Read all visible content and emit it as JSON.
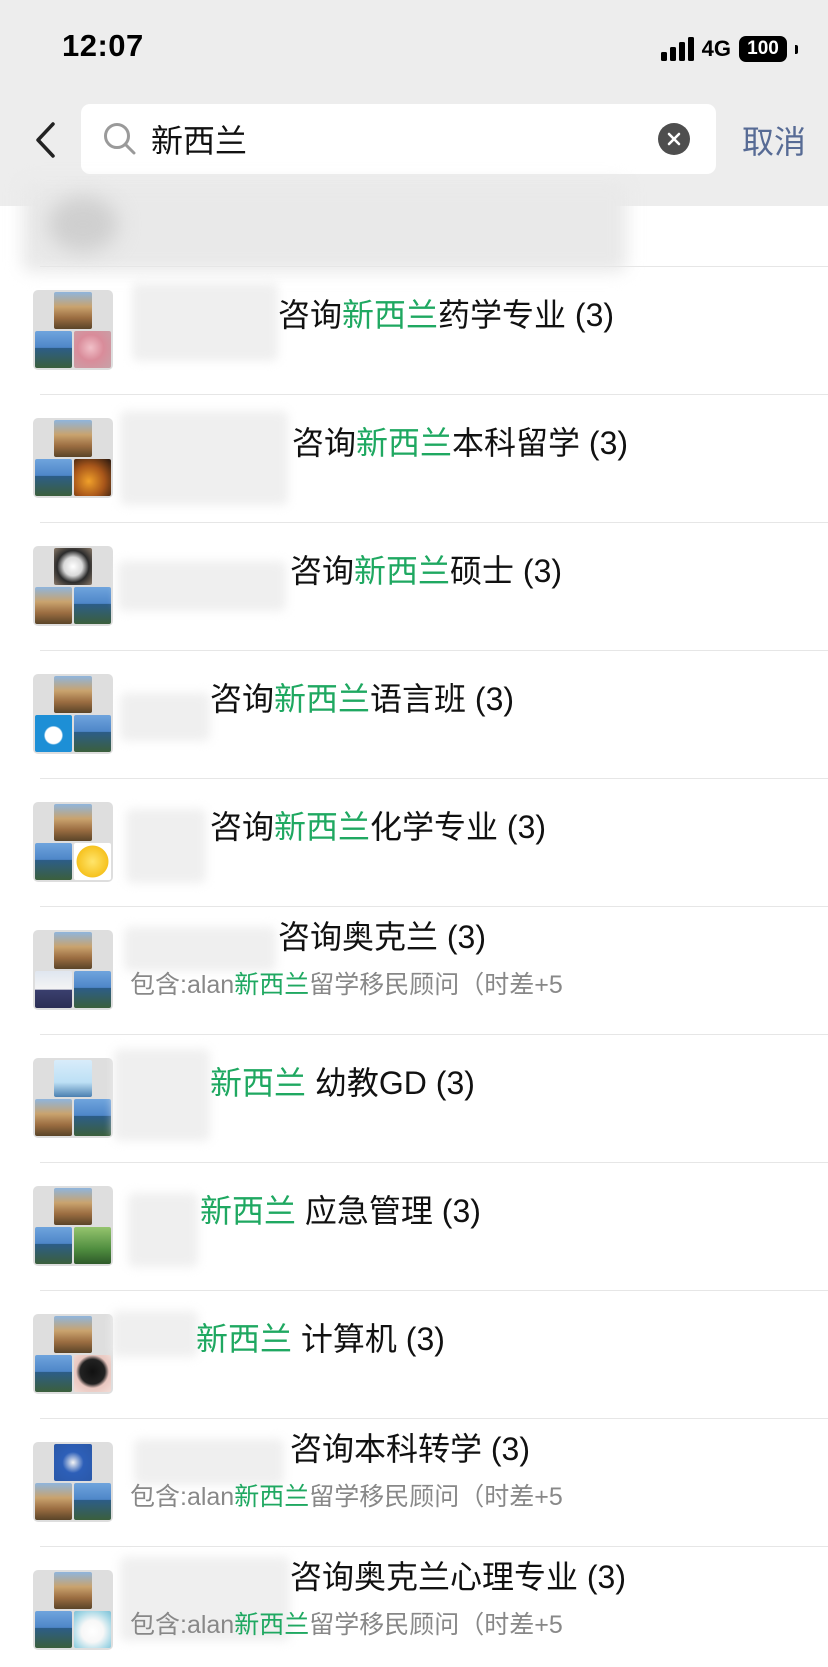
{
  "status_bar": {
    "time": "12:07",
    "network": "4G",
    "battery": "100"
  },
  "search": {
    "query": "新西兰",
    "cancel_label": "取消"
  },
  "results": [
    {
      "before": "咨询",
      "highlight": "新西兰",
      "after": "药学专业 (3)",
      "sub_before": "",
      "sub_highlight": "",
      "sub_after": "",
      "avatar": [
        "town",
        "lake",
        "flower"
      ]
    },
    {
      "before": "咨询",
      "highlight": "新西兰",
      "after": "本科留学 (3)",
      "sub_before": "",
      "sub_highlight": "",
      "sub_after": "",
      "avatar": [
        "town",
        "lake",
        "night"
      ]
    },
    {
      "before": "咨询",
      "highlight": "新西兰",
      "after": "硕士 (3)",
      "sub_before": "",
      "sub_highlight": "",
      "sub_after": "",
      "avatar": [
        "dog",
        "town",
        "lake"
      ]
    },
    {
      "before": "咨询",
      "highlight": "新西兰",
      "after": "语言班 (3)",
      "sub_before": "",
      "sub_highlight": "",
      "sub_after": "",
      "avatar": [
        "town",
        "cartoon",
        "lake"
      ]
    },
    {
      "before": "咨询",
      "highlight": "新西兰",
      "after": "化学专业 (3)",
      "sub_before": "",
      "sub_highlight": "",
      "sub_after": "",
      "avatar": [
        "town",
        "lake",
        "emoji"
      ]
    },
    {
      "before": "咨询奥克兰 (3)",
      "highlight": "",
      "after": "",
      "sub_before": "包含:alan",
      "sub_highlight": "新西兰",
      "sub_after": "留学移民顾问（时差+5",
      "avatar": [
        "town",
        "person",
        "lake"
      ]
    },
    {
      "before": "",
      "highlight": "新西兰",
      "after": " 幼教GD (3)",
      "sub_before": "",
      "sub_highlight": "",
      "sub_after": "",
      "avatar": [
        "sky",
        "town",
        "lake"
      ]
    },
    {
      "before": "",
      "highlight": "新西兰",
      "after": " 应急管理 (3)",
      "sub_before": "",
      "sub_highlight": "",
      "sub_after": "",
      "avatar": [
        "town",
        "lake",
        "green"
      ]
    },
    {
      "before": "",
      "highlight": "新西兰",
      "after": " 计算机 (3)",
      "sub_before": "",
      "sub_highlight": "",
      "sub_after": "",
      "avatar": [
        "town",
        "lake",
        "dark"
      ]
    },
    {
      "before": "咨询本科转学 (3)",
      "highlight": "",
      "after": "",
      "sub_before": "包含:alan",
      "sub_highlight": "新西兰",
      "sub_after": "留学移民顾问（时差+5",
      "avatar": [
        "sonic",
        "town",
        "lake"
      ]
    },
    {
      "before": "咨询奥克兰心理专业 (3)",
      "highlight": "",
      "after": "",
      "sub_before": "包含:alan",
      "sub_highlight": "新西兰",
      "sub_after": "留学移民顾问（时差+5",
      "avatar": [
        "town",
        "lake",
        "bear"
      ]
    }
  ],
  "colors": {
    "highlight": "#1fa861",
    "cancel": "#576b95",
    "subtext": "#888888"
  },
  "icons": {
    "back": "chevron-left-icon",
    "search": "search-icon",
    "clear": "clear-icon"
  }
}
